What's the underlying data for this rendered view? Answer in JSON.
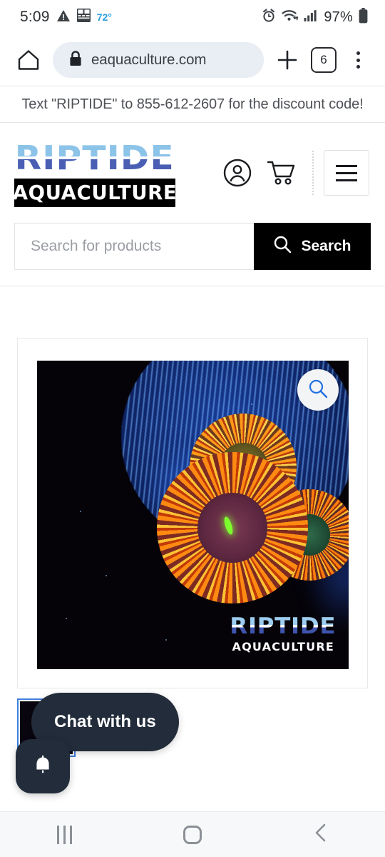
{
  "status_bar": {
    "time": "5:09",
    "temperature": "72°",
    "battery": "97%",
    "icons": [
      "warning-triangle-icon",
      "weather-widget-icon",
      "alarm-icon",
      "wifi-icon",
      "cellular-signal-icon",
      "battery-icon"
    ]
  },
  "browser": {
    "url": "eaquaculture.com",
    "tab_count": "6",
    "icons": [
      "home-icon",
      "lock-icon",
      "new-tab-plus-icon",
      "tabs-icon",
      "overflow-menu-icon"
    ]
  },
  "promo": {
    "text": "Text \"RIPTIDE\" to 855-612-2607 for the discount code!"
  },
  "site_header": {
    "logo_word": "RIPTIDE",
    "logo_sub": "AQUACULTURE",
    "account_label": "Account",
    "cart_label": "Cart",
    "menu_label": "Menu"
  },
  "search": {
    "placeholder": "Search for products",
    "value": "",
    "button_label": "Search"
  },
  "product": {
    "image_alt": "Orange zoanthid coral polyp colony on blue frag disc",
    "zoom_label": "Zoom",
    "watermark_word": "RIPTIDE",
    "watermark_sub": "AQUACULTURE",
    "thumbnails": [
      {
        "alt": "Coral thumbnail 1",
        "selected": true
      }
    ]
  },
  "chat": {
    "bubble_text": "Chat with us",
    "fab_icon": "bell-icon"
  },
  "nav_bar": {
    "recents_label": "Recents",
    "home_label": "Home",
    "back_label": "Back"
  },
  "colors": {
    "accent_blue": "#3f7fe0",
    "chat_dark": "#222c3a",
    "search_button": "#000000",
    "logo_light_blue": "#8cc3e8",
    "logo_dark_blue": "#4a5fb4",
    "temp_blue": "#2f9fe0"
  }
}
